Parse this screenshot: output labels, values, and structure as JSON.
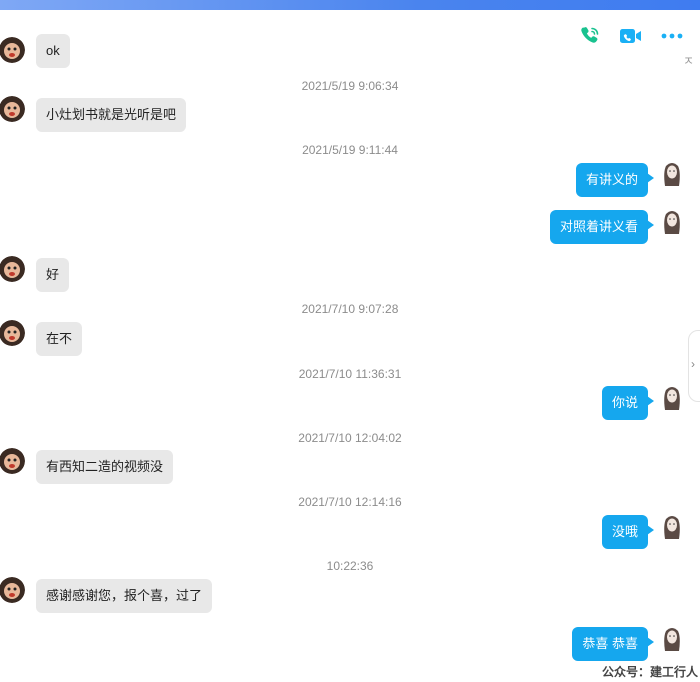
{
  "header": {
    "icons": [
      "phone-icon",
      "video-icon",
      "more-icon"
    ],
    "collapse_label": "ㅈ"
  },
  "colors": {
    "accent": "#15a7ee",
    "incoming_bubble": "#e8e8e8",
    "call_icon": "#19c28f",
    "video_icon": "#1ab0f5"
  },
  "messages": [
    {
      "type": "in",
      "text": "ok"
    },
    {
      "type": "ts",
      "text": "2021/5/19 9:06:34"
    },
    {
      "type": "in",
      "text": "小灶划书就是光听是吧"
    },
    {
      "type": "ts",
      "text": "2021/5/19 9:11:44"
    },
    {
      "type": "out",
      "text": "有讲义的"
    },
    {
      "type": "out",
      "text": "对照着讲义看"
    },
    {
      "type": "in",
      "text": "好"
    },
    {
      "type": "ts",
      "text": "2021/7/10 9:07:28"
    },
    {
      "type": "in",
      "text": "在不"
    },
    {
      "type": "ts",
      "text": "2021/7/10 11:36:31"
    },
    {
      "type": "out",
      "text": "你说"
    },
    {
      "type": "ts",
      "text": "2021/7/10 12:04:02"
    },
    {
      "type": "in",
      "text": "有西知二造的视频没"
    },
    {
      "type": "ts",
      "text": "2021/7/10 12:14:16"
    },
    {
      "type": "out",
      "text": "没哦"
    },
    {
      "type": "ts",
      "text": "10:22:36"
    },
    {
      "type": "in",
      "text": "感谢感谢您，报个喜，过了"
    },
    {
      "type": "out",
      "text": "恭喜 恭喜"
    }
  ],
  "watermark": "公众号：建工行人"
}
